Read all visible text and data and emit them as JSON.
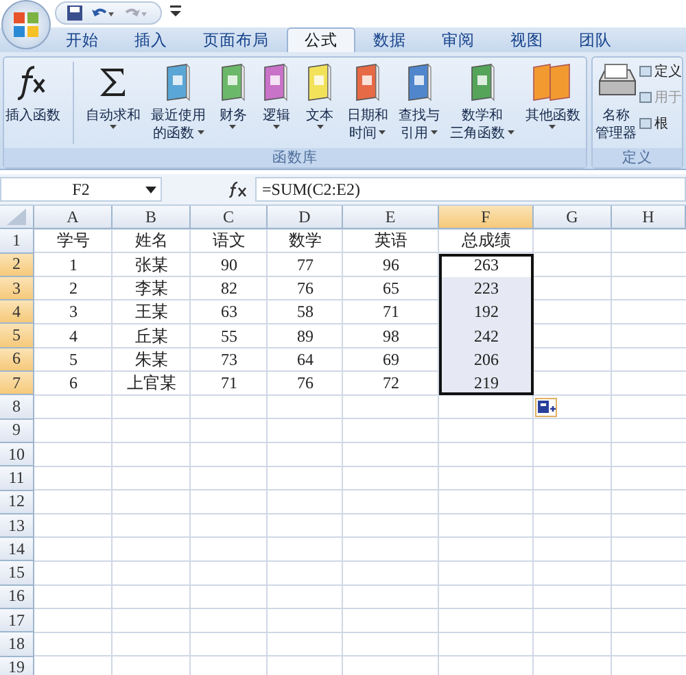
{
  "tabs": [
    {
      "label": "开始",
      "selected": false
    },
    {
      "label": "插入",
      "selected": false
    },
    {
      "label": "页面布局",
      "selected": false
    },
    {
      "label": "公式",
      "selected": true
    },
    {
      "label": "数据",
      "selected": false
    },
    {
      "label": "审阅",
      "selected": false
    },
    {
      "label": "视图",
      "selected": false
    },
    {
      "label": "团队",
      "selected": false
    }
  ],
  "ribbon": {
    "groups": [
      {
        "label": "函数库",
        "buttons": [
          {
            "kind": "fx",
            "lines": [
              "插入函数"
            ],
            "dropdown": false
          },
          {
            "kind": "sigma",
            "lines": [
              "自动求和"
            ],
            "dropdown": true
          },
          {
            "kind": "book",
            "color": "#5aa6d6",
            "lines": [
              "最近使用",
              "的函数"
            ],
            "dropdown": true
          },
          {
            "kind": "book",
            "color": "#6cb86a",
            "lines": [
              "财务"
            ],
            "dropdown": true
          },
          {
            "kind": "book",
            "color": "#c872c8",
            "lines": [
              "逻辑"
            ],
            "dropdown": true
          },
          {
            "kind": "book",
            "color": "#f2e25a",
            "lines": [
              "文本"
            ],
            "dropdown": true
          },
          {
            "kind": "book",
            "color": "#e66a46",
            "lines": [
              "日期和",
              "时间"
            ],
            "dropdown": true
          },
          {
            "kind": "book",
            "color": "#4f86cc",
            "lines": [
              "查找与",
              "引用"
            ],
            "dropdown": true
          },
          {
            "kind": "book",
            "color": "#55a45a",
            "lines": [
              "数学和",
              "三角函数"
            ],
            "dropdown": true
          },
          {
            "kind": "books",
            "color": "#f29a30",
            "lines": [
              "其他函数"
            ],
            "dropdown": true
          }
        ]
      },
      {
        "label": "定义",
        "buttons": [
          {
            "kind": "cabinet",
            "lines": [
              "名称",
              "管理器"
            ],
            "dropdown": false
          }
        ],
        "small": [
          "定义",
          "用于",
          "根"
        ]
      }
    ]
  },
  "name_box": "F2",
  "formula": "=SUM(C2:E2)",
  "columns": [
    {
      "label": "A",
      "selected": false
    },
    {
      "label": "B",
      "selected": false
    },
    {
      "label": "C",
      "selected": false
    },
    {
      "label": "D",
      "selected": false
    },
    {
      "label": "E",
      "selected": false
    },
    {
      "label": "F",
      "selected": true
    },
    {
      "label": "G",
      "selected": false
    },
    {
      "label": "H",
      "selected": false
    }
  ],
  "rows": [
    {
      "number": "1",
      "selected": false,
      "cells": [
        "学号",
        "姓名",
        "语文",
        "数学",
        "英语",
        "总成绩"
      ]
    },
    {
      "number": "2",
      "selected": true,
      "cells": [
        "1",
        "张某",
        "90",
        "77",
        "96",
        "263"
      ]
    },
    {
      "number": "3",
      "selected": true,
      "cells": [
        "2",
        "李某",
        "82",
        "76",
        "65",
        "223"
      ]
    },
    {
      "number": "4",
      "selected": true,
      "cells": [
        "3",
        "王某",
        "63",
        "58",
        "71",
        "192"
      ]
    },
    {
      "number": "5",
      "selected": true,
      "cells": [
        "4",
        "丘某",
        "55",
        "89",
        "98",
        "242"
      ]
    },
    {
      "number": "6",
      "selected": true,
      "cells": [
        "5",
        "朱某",
        "73",
        "64",
        "69",
        "206"
      ]
    },
    {
      "number": "7",
      "selected": true,
      "cells": [
        "6",
        "上官某",
        "71",
        "76",
        "72",
        "219"
      ]
    },
    {
      "number": "8",
      "selected": false,
      "cells": []
    },
    {
      "number": "9",
      "selected": false,
      "cells": []
    },
    {
      "number": "10",
      "selected": false,
      "cells": []
    },
    {
      "number": "11",
      "selected": false,
      "cells": []
    },
    {
      "number": "12",
      "selected": false,
      "cells": []
    },
    {
      "number": "13",
      "selected": false,
      "cells": []
    },
    {
      "number": "14",
      "selected": false,
      "cells": []
    },
    {
      "number": "15",
      "selected": false,
      "cells": []
    },
    {
      "number": "16",
      "selected": false,
      "cells": []
    },
    {
      "number": "17",
      "selected": false,
      "cells": []
    },
    {
      "number": "18",
      "selected": false,
      "cells": []
    },
    {
      "number": "19",
      "selected": false,
      "cells": []
    }
  ]
}
